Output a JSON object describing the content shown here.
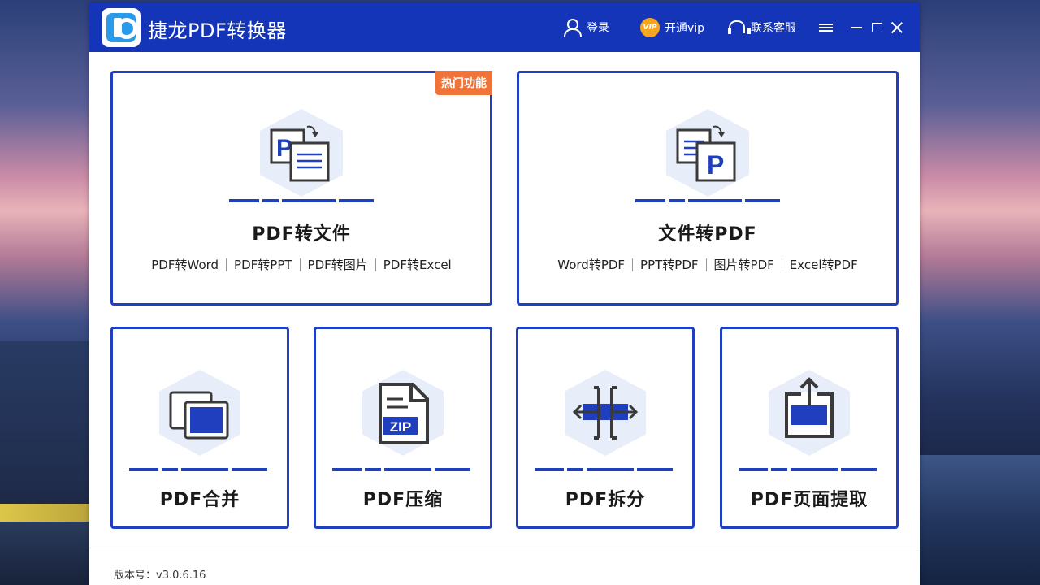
{
  "app": {
    "title": "捷龙PDF转换器"
  },
  "titlebar": {
    "login": "登录",
    "vip_badge": "VIP",
    "vip": "开通vip",
    "service": "联系客服"
  },
  "cards": {
    "pdf_to_file": {
      "badge": "热门功能",
      "title": "PDF转文件",
      "subs": [
        "PDF转Word",
        "PDF转PPT",
        "PDF转图片",
        "PDF转Excel"
      ]
    },
    "file_to_pdf": {
      "title": "文件转PDF",
      "subs": [
        "Word转PDF",
        "PPT转PDF",
        "图片转PDF",
        "Excel转PDF"
      ]
    },
    "merge": {
      "title": "PDF合并"
    },
    "compress": {
      "title": "PDF压缩",
      "icon_text": "ZIP"
    },
    "split": {
      "title": "PDF拆分"
    },
    "extract": {
      "title": "PDF页面提取"
    }
  },
  "footer": {
    "version": "版本号：v3.0.6.16"
  },
  "colors": {
    "titlebar": "#1535b8",
    "accent": "#1f3fbf",
    "hot_badge": "#f0743a",
    "vip": "#f5a623"
  }
}
